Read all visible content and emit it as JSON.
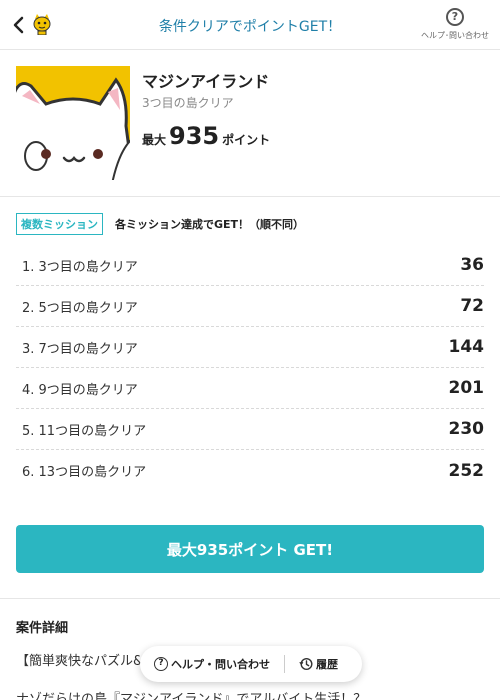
{
  "header": {
    "title": "条件クリアでポイントGET！",
    "help_label": "ヘルプ･問い合わせ",
    "help_icon": "?"
  },
  "campaign": {
    "title": "マジンアイランド",
    "subtitle": "3つ目の島クリア",
    "max_prefix": "最大",
    "max_points": "935",
    "points_unit": "ポイント"
  },
  "missions": {
    "badge": "複数ミッション",
    "note": "各ミッション達成でGET！（順不同）",
    "items": [
      {
        "label": "1. 3つ目の島クリア",
        "points": "36"
      },
      {
        "label": "2. 5つ目の島クリア",
        "points": "72"
      },
      {
        "label": "3. 7つ目の島クリア",
        "points": "144"
      },
      {
        "label": "4. 9つ目の島クリア",
        "points": "201"
      },
      {
        "label": "5. 11つ目の島クリア",
        "points": "230"
      },
      {
        "label": "6. 13つ目の島クリア",
        "points": "252"
      }
    ]
  },
  "cta": {
    "label": "最大935ポイント GET!"
  },
  "details": {
    "title": "案件詳細",
    "line1": "【簡単爽快なパズル&",
    "line2": "ナゾだらけの島『マジンアイランド』でアルバイト生活！？"
  },
  "floatbar": {
    "help_label": "ヘルプ・問い合わせ",
    "history_label": "履歴"
  },
  "colors": {
    "accent": "#2bb6c1",
    "header_title": "#1f7fa8",
    "thumb_bg": "#f2c200"
  }
}
